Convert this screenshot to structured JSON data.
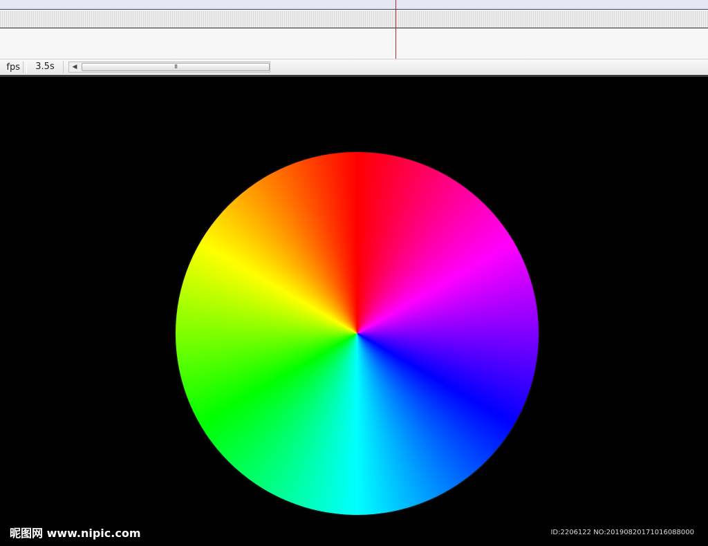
{
  "statusbar": {
    "fps_label": "fps",
    "time_label": "3.5s",
    "scroll_left_arrow": "◀",
    "scroll_grip": "III"
  },
  "stage": {
    "wheel_colors": [
      "#ff0000",
      "#ff00ff",
      "#0000ff",
      "#00ffff",
      "#00ff00",
      "#ffff00"
    ]
  },
  "watermark": {
    "site": "昵图网 www.nipic.com",
    "id_text": "ID:2206122 NO:20190820171016088000"
  },
  "colors": {
    "playhead": "#b52a2a",
    "stage_background": "#000000"
  }
}
